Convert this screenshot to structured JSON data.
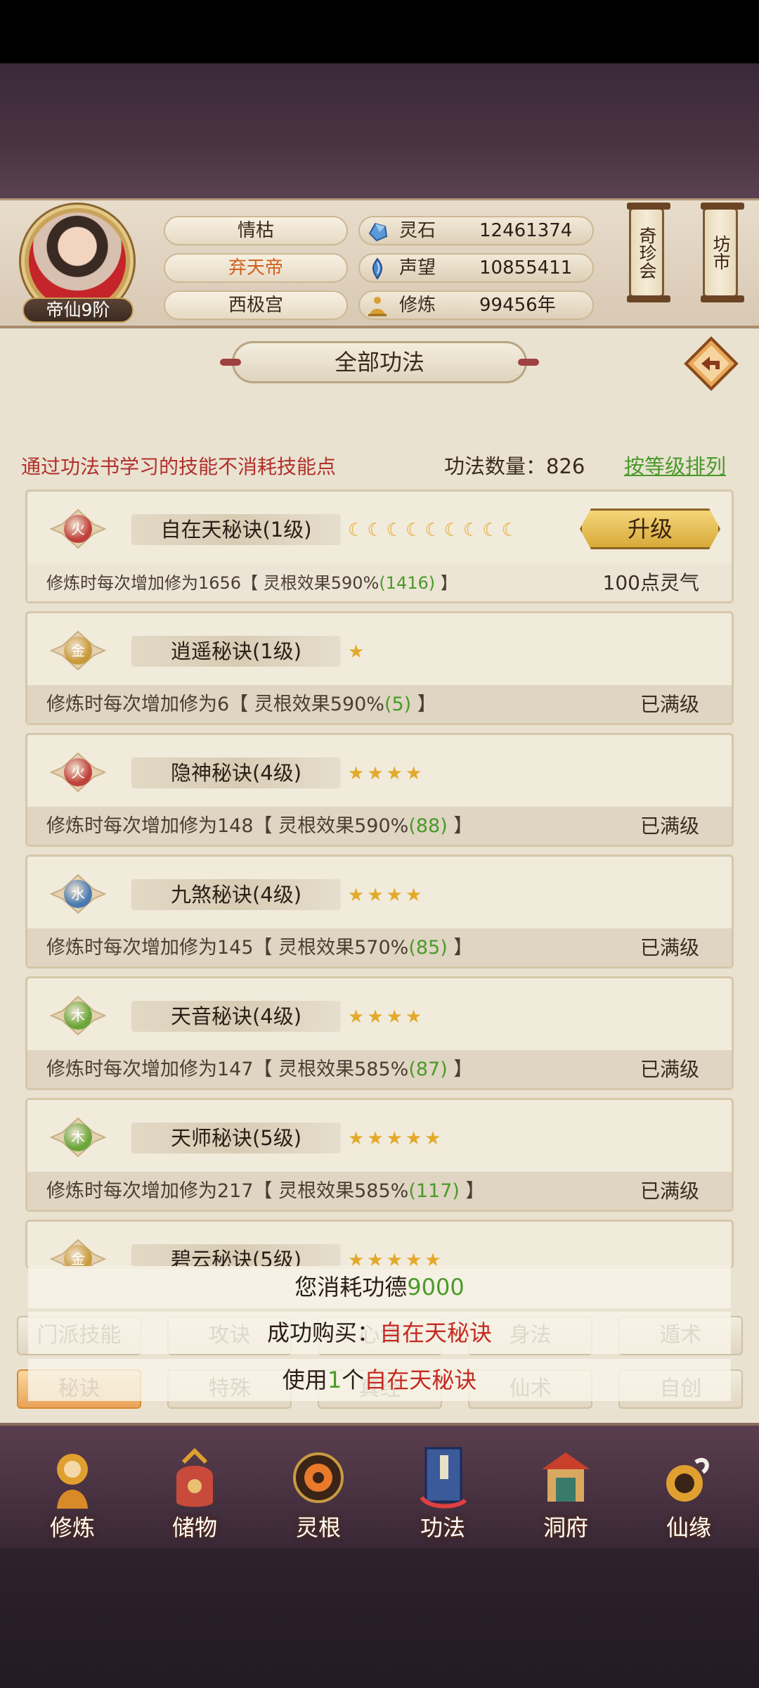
{
  "profile": {
    "rank": "帝仙9阶",
    "name": "情枯",
    "title": "弃天帝",
    "location": "西极宫",
    "stats": [
      {
        "icon": "spirit-stone-icon",
        "label": "灵石",
        "value": "12461374"
      },
      {
        "icon": "reputation-icon",
        "label": "声望",
        "value": "10855411"
      },
      {
        "icon": "cultivation-icon",
        "label": "修炼",
        "value": "99456年"
      }
    ],
    "buttons": {
      "treasure": "奇珍会",
      "market": "坊市"
    }
  },
  "panel": {
    "title": "全部功法",
    "notice": "通过功法书学习的技能不消耗技能点",
    "count_label": "功法数量：826",
    "sort_link": "按等级排列"
  },
  "skills": [
    {
      "element": "火",
      "name": "自在天秘诀(1级)",
      "level_icon": "moon",
      "level_count": 9,
      "effect_prefix": "修炼时每次增加修为1656【 灵根效果590%",
      "effect_bonus": "(1416)",
      "effect_suffix": " 】",
      "status": "100点灵气",
      "button": "升级"
    },
    {
      "element": "金",
      "name": "逍遥秘诀(1级)",
      "level_icon": "star",
      "level_count": 1,
      "effect_prefix": "修炼时每次增加修为6【 灵根效果590%",
      "effect_bonus": "(5)",
      "effect_suffix": " 】",
      "status": "已满级"
    },
    {
      "element": "火",
      "name": "隐神秘诀(4级)",
      "level_icon": "star",
      "level_count": 4,
      "effect_prefix": "修炼时每次增加修为148【 灵根效果590%",
      "effect_bonus": "(88)",
      "effect_suffix": " 】",
      "status": "已满级"
    },
    {
      "element": "水",
      "name": "九煞秘诀(4级)",
      "level_icon": "star",
      "level_count": 4,
      "effect_prefix": "修炼时每次增加修为145【 灵根效果570%",
      "effect_bonus": "(85)",
      "effect_suffix": " 】",
      "status": "已满级"
    },
    {
      "element": "木",
      "name": "天音秘诀(4级)",
      "level_icon": "star",
      "level_count": 4,
      "effect_prefix": "修炼时每次增加修为147【 灵根效果585%",
      "effect_bonus": "(87)",
      "effect_suffix": " 】",
      "status": "已满级"
    },
    {
      "element": "木",
      "name": "天师秘诀(5级)",
      "level_icon": "star",
      "level_count": 5,
      "effect_prefix": "修炼时每次增加修为217【 灵根效果585%",
      "effect_bonus": "(117)",
      "effect_suffix": " 】",
      "status": "已满级"
    },
    {
      "element": "金",
      "name": "碧云秘诀(5级)",
      "level_icon": "star",
      "level_count": 5,
      "effect_prefix": "",
      "effect_bonus": "",
      "effect_suffix": "",
      "status": ""
    }
  ],
  "element_colors": {
    "火": "#c0403a",
    "金": "#c99a3a",
    "水": "#4a78b0",
    "木": "#6aa63a"
  },
  "toasts": {
    "cost_prefix": "您消耗功德",
    "cost_value": "9000",
    "purchase_prefix": "成功购买：",
    "purchase_item": "自在天秘诀",
    "use_prefix": "使用",
    "use_count": "1",
    "use_mid": "个",
    "use_item": "自在天秘诀"
  },
  "tabs": [
    [
      "门派技能",
      "攻诀",
      "心法",
      "身法",
      "遁术"
    ],
    [
      "秘诀",
      "特殊",
      "真经",
      "仙术",
      "自创"
    ]
  ],
  "active_tab": "秘诀",
  "nav": [
    {
      "label": "修炼",
      "icon": "cultivate-icon"
    },
    {
      "label": "储物",
      "icon": "storage-bag-icon"
    },
    {
      "label": "灵根",
      "icon": "spirit-root-icon"
    },
    {
      "label": "功法",
      "icon": "technique-book-icon"
    },
    {
      "label": "洞府",
      "icon": "cave-dwelling-icon"
    },
    {
      "label": "仙缘",
      "icon": "immortal-fate-icon"
    }
  ]
}
